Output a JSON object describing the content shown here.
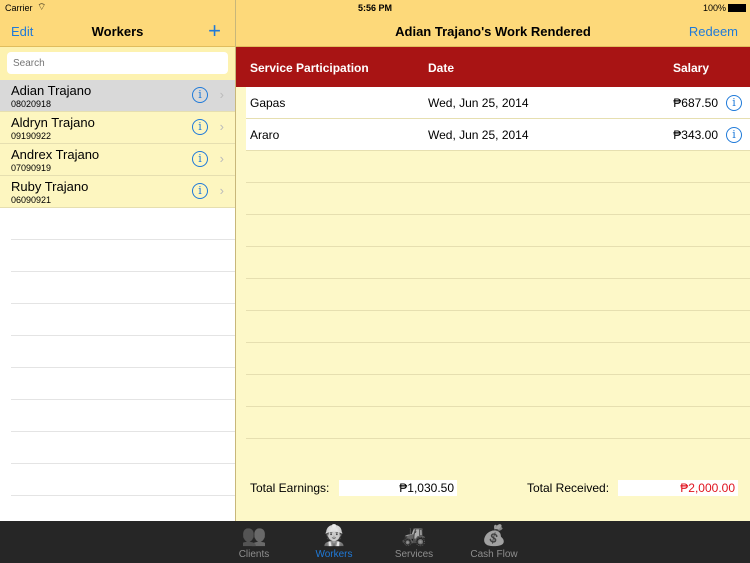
{
  "status": {
    "carrier": "Carrier",
    "time": "5:56 PM",
    "battery": "100%"
  },
  "left_nav": {
    "edit": "Edit",
    "title": "Workers",
    "add": "+"
  },
  "search": {
    "placeholder": "Search"
  },
  "workers": [
    {
      "name": "Adian Trajano",
      "id": "08020918",
      "selected": true
    },
    {
      "name": "Aldryn Trajano",
      "id": "09190922"
    },
    {
      "name": "Andrex Trajano",
      "id": "07090919"
    },
    {
      "name": "Ruby Trajano",
      "id": "06090921"
    }
  ],
  "right_nav": {
    "title": "Adian Trajano's Work Rendered",
    "redeem": "Redeem"
  },
  "table": {
    "headers": [
      "Service Participation",
      "Date",
      "Salary"
    ],
    "rows": [
      {
        "service": "Gapas",
        "date": "Wed, Jun 25, 2014",
        "salary": "₱687.50"
      },
      {
        "service": "Araro",
        "date": "Wed, Jun 25, 2014",
        "salary": "₱343.00"
      }
    ]
  },
  "footer": {
    "earnings_label": "Total Earnings:",
    "earnings": "₱1,030.50",
    "received_label": "Total Received:",
    "received": "₱2,000.00",
    "received_color": "#e0131f"
  },
  "tabs": [
    {
      "label": "Clients",
      "icon": "clients-icon"
    },
    {
      "label": "Workers",
      "icon": "worker-icon",
      "active": true
    },
    {
      "label": "Services",
      "icon": "tractor-icon"
    },
    {
      "label": "Cash Flow",
      "icon": "cash-flow-icon"
    }
  ]
}
